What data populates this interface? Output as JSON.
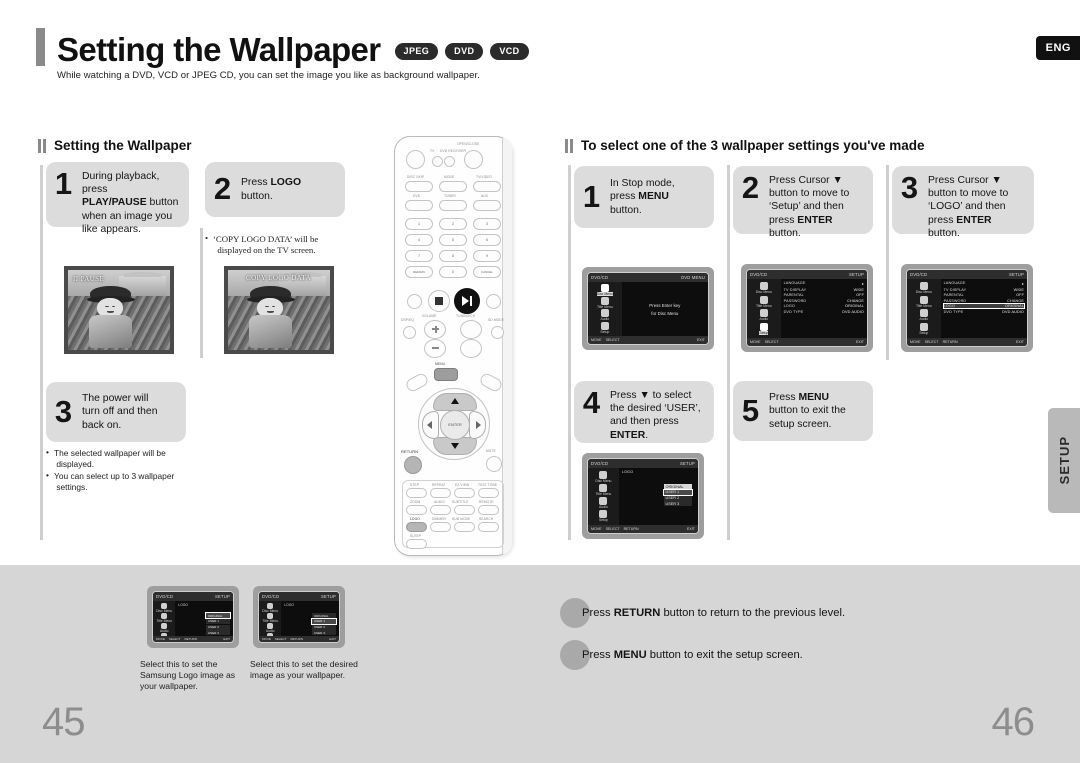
{
  "header": {
    "title": "Setting the Wallpaper",
    "badges": [
      "JPEG",
      "DVD",
      "VCD"
    ],
    "subtitle": "While watching a DVD, VCD or JPEG CD, you can set the image you like as background wallpaper.",
    "lang_tab": "ENG",
    "side_tab": "SETUP"
  },
  "left_section": {
    "heading": "Setting the Wallpaper",
    "steps": [
      {
        "num": "1",
        "lines": [
          "During playback, press",
          "PLAY/PAUSE button",
          "when an image you",
          "like appears."
        ],
        "bold": [
          "PLAY/PAUSE"
        ]
      },
      {
        "num": "2",
        "lines": [
          "Press LOGO",
          "button."
        ],
        "bold": [
          "LOGO"
        ]
      },
      {
        "num": "3",
        "lines": [
          "The power will",
          "turn off and then",
          "back on."
        ],
        "bold": []
      }
    ],
    "step2_note": "‘COPY LOGO DATA’ will be displayed on the TV screen.",
    "step3_notes": [
      "The selected wallpaper will be displayed.",
      "You can select up to 3 wallpaper settings."
    ],
    "photo1_overlay": "II PAUSE",
    "photo2_overlay": "COPY LOGO DATA"
  },
  "right_section": {
    "heading": "To select one of the 3 wallpaper settings you've made",
    "steps": [
      {
        "num": "1",
        "lines": [
          "In Stop mode,",
          "press MENU",
          "button."
        ]
      },
      {
        "num": "2",
        "lines": [
          "Press Cursor ▼",
          "button to move to",
          "‘Setup’ and then",
          "press ENTER button."
        ]
      },
      {
        "num": "3",
        "lines": [
          "Press Cursor ▼",
          "button to move to",
          "‘LOGO’ and then",
          "press ENTER button."
        ]
      },
      {
        "num": "4",
        "lines": [
          "Press ▼ to select",
          "the desired ‘USER’,",
          "and then press",
          "ENTER."
        ]
      },
      {
        "num": "5",
        "lines": [
          "Press MENU",
          "button to exit the",
          "setup screen."
        ]
      }
    ]
  },
  "osd": {
    "title_left": "DVD/CD",
    "title_right": "SETUP",
    "rail": [
      {
        "label": "Disc Menu",
        "icon": "disc-menu-icon"
      },
      {
        "label": "Title Menu",
        "icon": "title-menu-icon"
      },
      {
        "label": "Audio",
        "icon": "audio-icon"
      },
      {
        "label": "Setup",
        "icon": "setup-gear-icon"
      }
    ],
    "center_lines": [
      "Press Enter key",
      "for Disc Menu"
    ],
    "setup_rows": [
      {
        "label": "LANGUAGE",
        "value": ""
      },
      {
        "label": "TV DISPLAY",
        "value": "WIDE"
      },
      {
        "label": "PARENTAL",
        "value": "OFF"
      },
      {
        "label": "PASSWORD",
        "value": "CHANGE"
      },
      {
        "label": "LOGO",
        "value": "ORIGINAL"
      },
      {
        "label": "DVD TYPE",
        "value": "DVD AUDIO"
      }
    ],
    "logo_label": "LOGO",
    "logo_options": [
      "ORIGINAL",
      "USER 1",
      "USER 2",
      "USER 3"
    ],
    "footer_keys": [
      "MOVE",
      "SELECT",
      "RETURN",
      "EXIT"
    ]
  },
  "bottom": {
    "captions": [
      "Select this to set the Samsung Logo image as your wallpaper.",
      "Select this to set the desired image as your wallpaper."
    ],
    "notes": [
      {
        "pre": "Press ",
        "key": "RETURN",
        "post": " button to return to the previous level."
      },
      {
        "pre": "Press ",
        "key": "MENU",
        "post": " button to exit the setup screen."
      }
    ],
    "page_left": "45",
    "page_right": "46"
  },
  "remote": {
    "top_labels": [
      "OPEN/CLOSE",
      "TV",
      "DVD RECEIVER"
    ],
    "row1": [
      "DISC SKIP",
      "MODE",
      "TV/VIDEO"
    ],
    "row2": [
      "DVD",
      "TUNER",
      "AUX"
    ],
    "numbers": [
      "1",
      "2",
      "3",
      "4",
      "5",
      "6",
      "7",
      "8",
      "9"
    ],
    "row_last": [
      "REMAIN",
      "0",
      "CANCEL"
    ],
    "transport": [
      "skip-back-icon",
      "stop-icon",
      "play-pause-icon",
      "skip-forward-icon"
    ],
    "mid_labels": [
      "VOLUME",
      "TUNING/CH"
    ],
    "side_labels": [
      "DSP/EQ",
      "SD MODE",
      "P.SCAN",
      "SLOW"
    ],
    "nav": {
      "menu": "MENU",
      "enter": "ENTER",
      "return": "RETURN",
      "mute": "MUTE"
    },
    "bottom_rows": [
      [
        "STEP",
        "REPEAT",
        "EZ VIEW",
        "TEST TONE"
      ],
      [
        "ZOOM",
        "AUDIO",
        "SUBTITLE",
        "REMOTE"
      ],
      [
        "LOGO",
        "DIMMER",
        "SUB MODE",
        "SEARCH"
      ],
      [
        "SLEEP"
      ]
    ],
    "highlight_button": "LOGO"
  },
  "colors": {
    "band": "#d6d6d6",
    "step_box": "#dcdcdc",
    "badge": "#2b2b2b",
    "accent_bar": "#8a8a8a"
  }
}
